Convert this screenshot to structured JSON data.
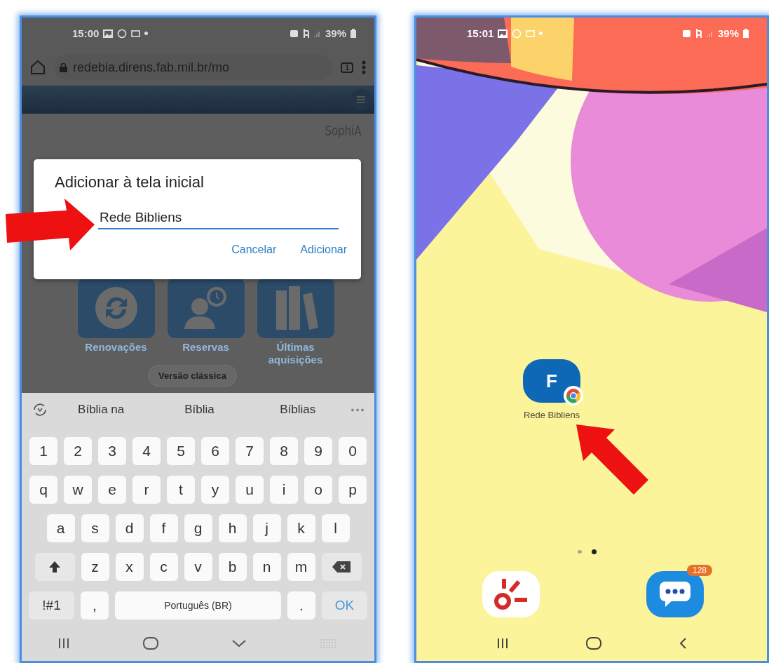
{
  "left_phone": {
    "status_bar": {
      "time": "15:00",
      "battery": "39%"
    },
    "browser": {
      "url": "redebia.direns.fab.mil.br/mo",
      "tab_count": "1"
    },
    "page": {
      "logo": "SophiA",
      "tiles": [
        {
          "kind": "refresh",
          "label": "Renovações"
        },
        {
          "kind": "reservation",
          "label": "Reservas"
        },
        {
          "kind": "books",
          "label": "Últimas aquisições"
        }
      ],
      "classic_button": "Versão clássica"
    },
    "dialog": {
      "title": "Adicionar à tela inicial",
      "value": "Rede Bibliens",
      "buttons": [
        "Cancelar",
        "Adicionar"
      ]
    },
    "keyboard": {
      "suggestions": [
        "Bíblia na",
        "Bíblia",
        "Bíblias"
      ],
      "rows": [
        {
          "keys": [
            {
              "kind": "char",
              "label": "1"
            },
            {
              "kind": "char",
              "label": "2"
            },
            {
              "kind": "char",
              "label": "3"
            },
            {
              "kind": "char",
              "label": "4"
            },
            {
              "kind": "char",
              "label": "5"
            },
            {
              "kind": "char",
              "label": "6"
            },
            {
              "kind": "char",
              "label": "7"
            },
            {
              "kind": "char",
              "label": "8"
            },
            {
              "kind": "char",
              "label": "9"
            },
            {
              "kind": "char",
              "label": "0"
            }
          ]
        },
        {
          "keys": [
            {
              "kind": "char",
              "label": "q"
            },
            {
              "kind": "char",
              "label": "w"
            },
            {
              "kind": "char",
              "label": "e"
            },
            {
              "kind": "char",
              "label": "r"
            },
            {
              "kind": "char",
              "label": "t"
            },
            {
              "kind": "char",
              "label": "y"
            },
            {
              "kind": "char",
              "label": "u"
            },
            {
              "kind": "char",
              "label": "i"
            },
            {
              "kind": "char",
              "label": "o"
            },
            {
              "kind": "char",
              "label": "p"
            }
          ]
        },
        {
          "keys": [
            {
              "kind": "char",
              "label": "a"
            },
            {
              "kind": "char",
              "label": "s"
            },
            {
              "kind": "char",
              "label": "d"
            },
            {
              "kind": "char",
              "label": "f"
            },
            {
              "kind": "char",
              "label": "g"
            },
            {
              "kind": "char",
              "label": "h"
            },
            {
              "kind": "char",
              "label": "j"
            },
            {
              "kind": "char",
              "label": "k"
            },
            {
              "kind": "char",
              "label": "l"
            }
          ]
        },
        {
          "keys": [
            {
              "kind": "shift"
            },
            {
              "kind": "char",
              "label": "z"
            },
            {
              "kind": "char",
              "label": "x"
            },
            {
              "kind": "char",
              "label": "c"
            },
            {
              "kind": "char",
              "label": "v"
            },
            {
              "kind": "char",
              "label": "b"
            },
            {
              "kind": "char",
              "label": "n"
            },
            {
              "kind": "char",
              "label": "m"
            },
            {
              "kind": "backspace"
            }
          ]
        },
        {
          "keys": [
            {
              "kind": "mod",
              "label": "!#1"
            },
            {
              "kind": "char",
              "label": ","
            },
            {
              "kind": "space",
              "label": "Português (BR)"
            },
            {
              "kind": "char",
              "label": "."
            },
            {
              "kind": "action",
              "label": "OK"
            }
          ]
        }
      ]
    }
  },
  "right_phone": {
    "status_bar": {
      "time": "15:01",
      "battery": "39%"
    },
    "shortcut": {
      "letter": "F",
      "label": "Rede Bibliens"
    },
    "page_dots": [
      {
        "selected": false
      },
      {
        "selected": true
      }
    ],
    "dock": [
      {
        "kind": "burst"
      },
      {
        "kind": "messages",
        "badge": "128"
      }
    ]
  }
}
